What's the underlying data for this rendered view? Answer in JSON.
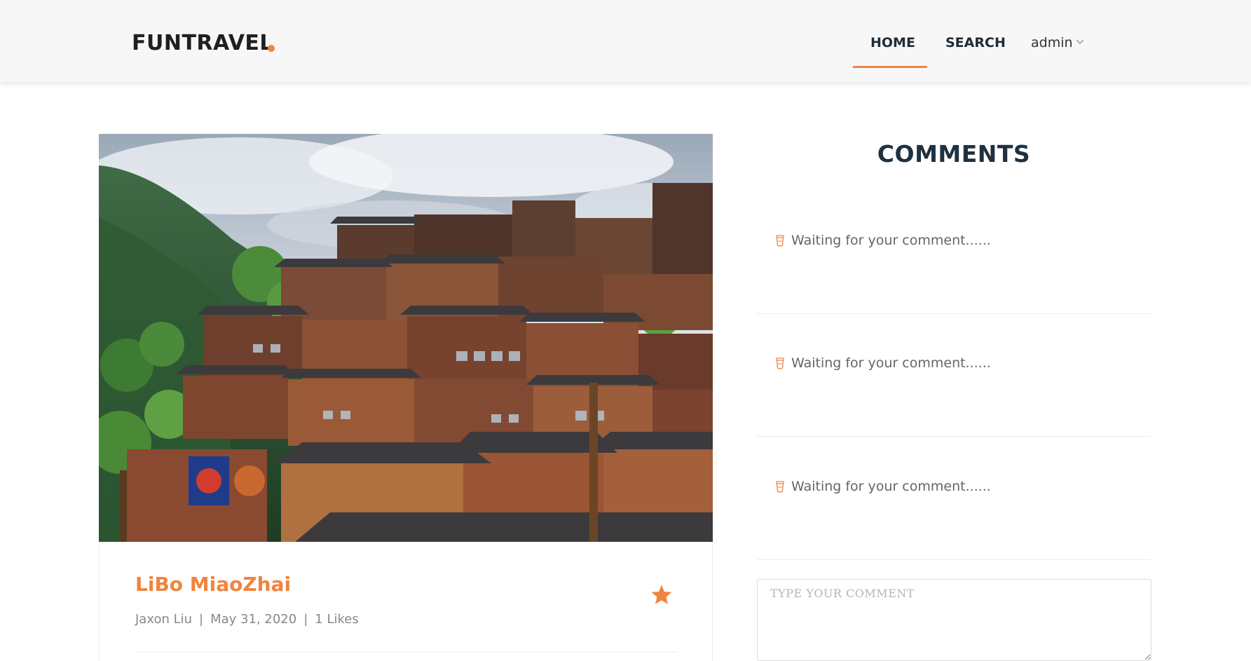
{
  "header": {
    "logo": "FUNTRAVEL",
    "nav": {
      "home": "HOME",
      "search": "SEARCH",
      "user": "admin"
    },
    "accent_color": "#f0843e"
  },
  "post": {
    "image_alt": "LiBo MiaoZhai",
    "title": "LiBo MiaoZhai",
    "author": "Jaxon Liu",
    "date": "May 31, 2020",
    "likes": "1 Likes",
    "favorited": true
  },
  "comments": {
    "title": "COMMENTS",
    "items": [
      {
        "text": "Waiting for your comment......",
        "icon": "flower-pot-icon"
      },
      {
        "text": "Waiting for your comment......",
        "icon": "flower-pot-icon"
      },
      {
        "text": "Waiting for your comment......",
        "icon": "flower-pot-icon"
      }
    ],
    "input": {
      "placeholder": "TYPE YOUR COMMENT",
      "value": ""
    }
  }
}
